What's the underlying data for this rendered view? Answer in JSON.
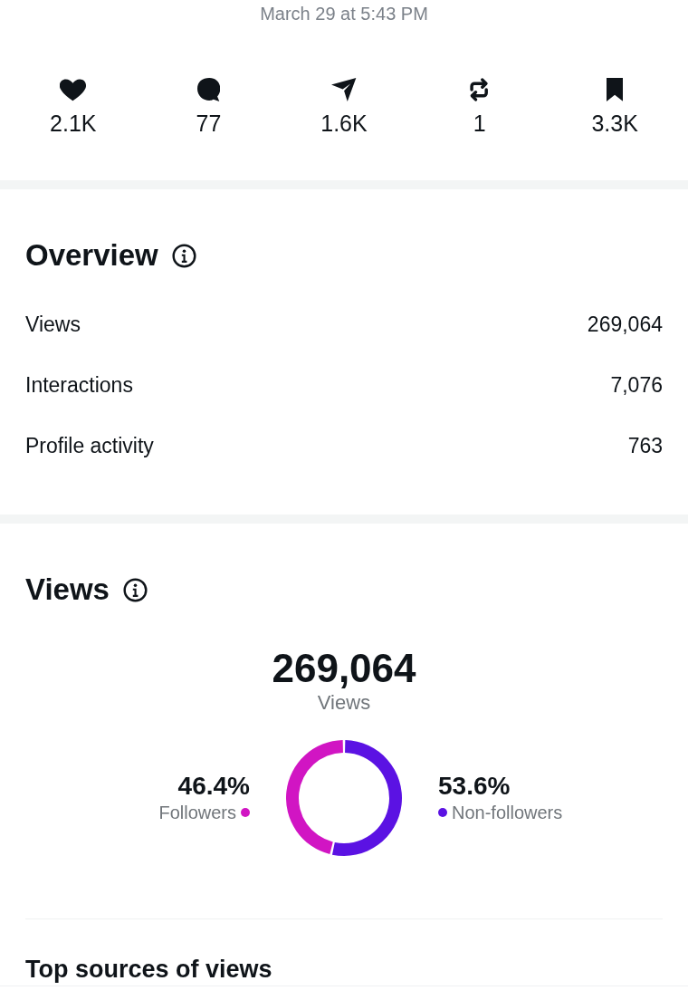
{
  "timestamp": "March 29 at 5:43 PM",
  "engagement": [
    {
      "kind": "likes",
      "count": "2.1K"
    },
    {
      "kind": "replies",
      "count": "77"
    },
    {
      "kind": "shares",
      "count": "1.6K"
    },
    {
      "kind": "reposts",
      "count": "1"
    },
    {
      "kind": "bookmarks",
      "count": "3.3K"
    }
  ],
  "overview": {
    "title": "Overview",
    "rows": [
      {
        "label": "Views",
        "value": "269,064"
      },
      {
        "label": "Interactions",
        "value": "7,076"
      },
      {
        "label": "Profile activity",
        "value": "763"
      }
    ]
  },
  "views": {
    "title": "Views",
    "total": "269,064",
    "total_label": "Views",
    "legend": [
      {
        "value": "46.4%",
        "color": "#d115c3"
      },
      {
        "value": "53.6%",
        "color": "#5b12e3"
      }
    ],
    "chart_data": {
      "type": "donut",
      "categories": [
        "Followers",
        "Non-followers"
      ],
      "values": [
        46.4,
        53.6
      ]
    }
  },
  "top_sources": {
    "title": "Top sources of views"
  }
}
